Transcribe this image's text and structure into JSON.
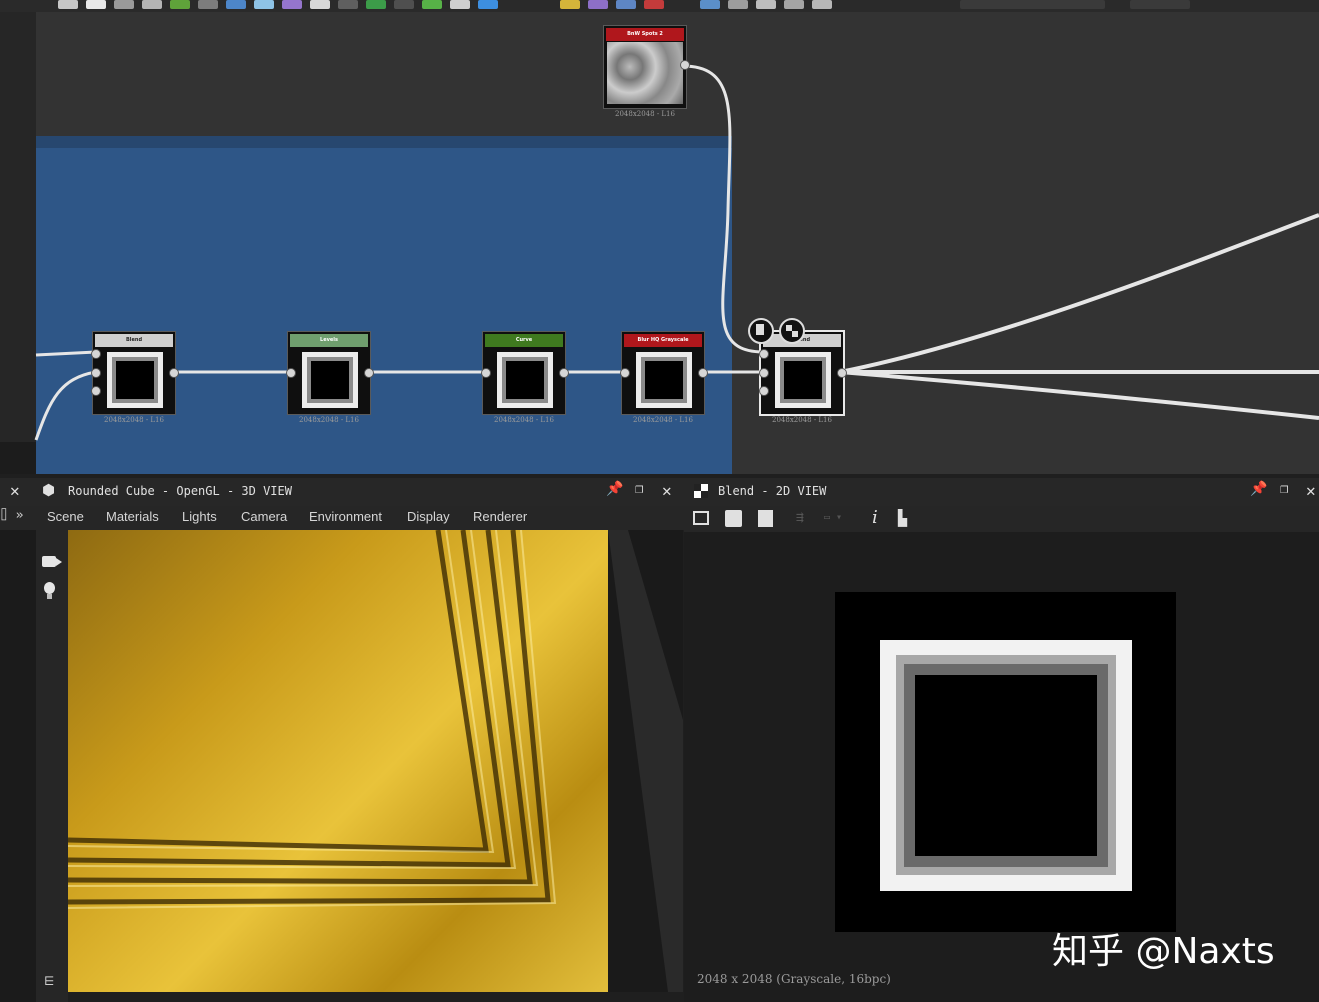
{
  "graph": {
    "top_node": {
      "title": "BnW Spots 2",
      "caption": "2048x2048 - L16",
      "header_color": "#b0171c"
    },
    "nodes": [
      {
        "title": "Blend",
        "caption": "2048x2048 - L16",
        "header_color": "#cfcfcf"
      },
      {
        "title": "Levels",
        "caption": "2048x2048 - L16",
        "header_color": "#6f9e6e"
      },
      {
        "title": "Curve",
        "caption": "2048x2048 - L16",
        "header_color": "#3f7a1f"
      },
      {
        "title": "Blur HQ Grayscale",
        "caption": "2048x2048 - L16",
        "header_color": "#b0171c"
      },
      {
        "title": "Blend",
        "caption": "2048x2048 - L16",
        "header_color": "#cfcfcf"
      }
    ],
    "frame_color": "#2e5687"
  },
  "panel3d": {
    "title": "Rounded Cube - OpenGL - 3D VIEW",
    "tabs": [
      "Scene",
      "Materials",
      "Lights",
      "Camera",
      "Environment",
      "Display",
      "Renderer"
    ],
    "side_icons": [
      "camera-icon",
      "light-bulb-icon"
    ]
  },
  "panel2d": {
    "title": "Blend - 2D VIEW",
    "status": "2048 x 2048 (Grayscale, 16bpc)"
  },
  "watermark": "知乎 @Naxts"
}
